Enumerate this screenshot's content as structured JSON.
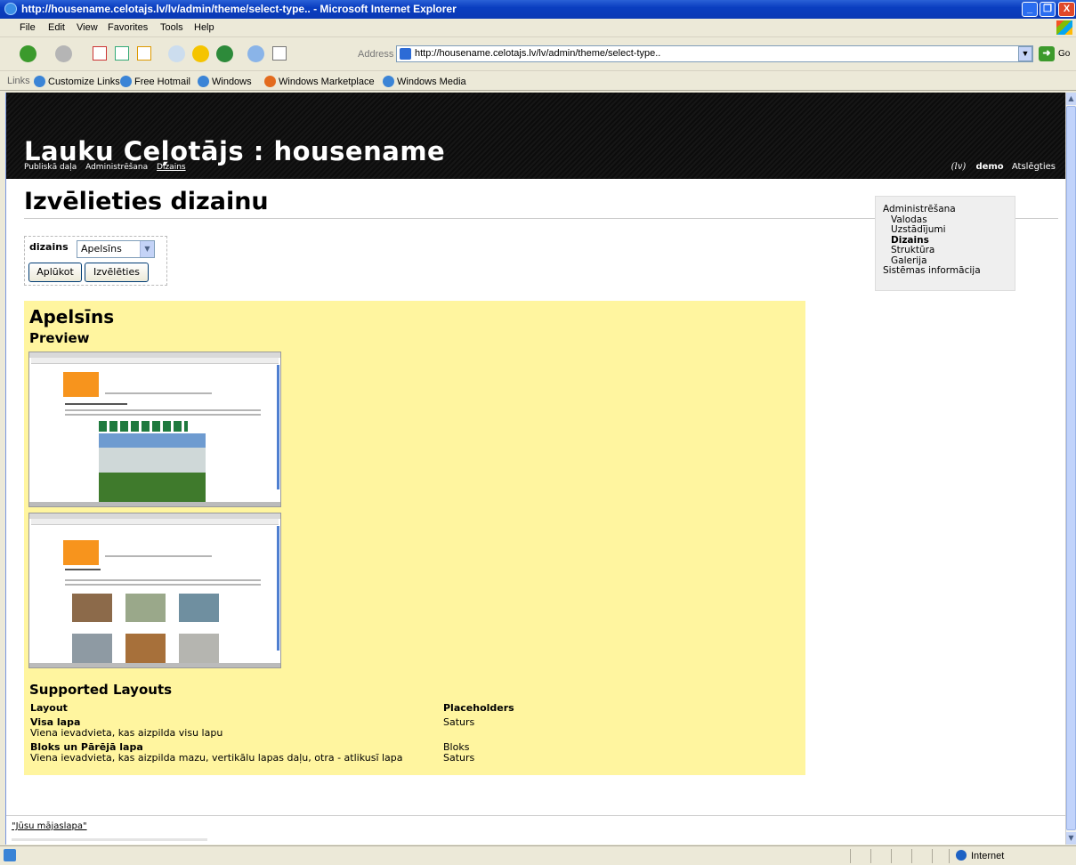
{
  "window": {
    "title": "http://housename.celotajs.lv/lv/admin/theme/select-type.. - Microsoft Internet Explorer",
    "minimize": "_",
    "restore": "❐",
    "close": "X"
  },
  "menubar": [
    "File",
    "Edit",
    "View",
    "Favorites",
    "Tools",
    "Help"
  ],
  "toolbar": {
    "address_label": "Address",
    "address_value": "http://housename.celotajs.lv/lv/admin/theme/select-type..",
    "go_label": "Go"
  },
  "links_bar": {
    "label": "Links",
    "items": [
      "Customize Links",
      "Free Hotmail",
      "Windows",
      "Windows Marketplace",
      "Windows Media"
    ]
  },
  "header": {
    "site_title": "Lauku Ceļotājs : housename",
    "nav": [
      "Publiskā daļa",
      "Administrēšana",
      "Dizains"
    ],
    "lang": "(lv)",
    "user": "demo",
    "logout": "Atslēgties"
  },
  "page": {
    "title": "Izvēlieties dizainu",
    "form": {
      "label": "dizains",
      "selected": "Apelsīns",
      "view_button": "Aplūkot",
      "choose_button": "Izvēlēties"
    },
    "theme": {
      "name": "Apelsīns",
      "preview_label": "Preview",
      "layouts_title": "Supported Layouts",
      "col_layout": "Layout",
      "col_placeholders": "Placeholders",
      "layouts": [
        {
          "name": "Visa lapa",
          "desc": "Viena ievadvieta, kas aizpilda visu lapu",
          "placeholders": [
            "Saturs"
          ]
        },
        {
          "name": "Bloks un Pārējā lapa",
          "desc": "Viena ievadvieta, kas aizpilda mazu, vertikālu lapas daļu, otra - atlikusī lapa",
          "placeholders": [
            "Bloks",
            "Saturs"
          ]
        }
      ]
    }
  },
  "sidebar": {
    "items": [
      {
        "label": "Administrēšana",
        "level": 0
      },
      {
        "label": "Valodas",
        "level": 1
      },
      {
        "label": "Uzstādījumi",
        "level": 1
      },
      {
        "label": "Dizains",
        "level": 1,
        "current": true
      },
      {
        "label": "Struktūra",
        "level": 1
      },
      {
        "label": "Galerija",
        "level": 1
      },
      {
        "label": "Sistēmas informācija",
        "level": 0
      }
    ]
  },
  "footer": {
    "link": "\"Jūsu mājaslapa\""
  },
  "status": {
    "zone": "Internet"
  },
  "colors": {
    "panel": "#fff59f",
    "header": "#000000",
    "accent_orange": "#f7941d"
  }
}
